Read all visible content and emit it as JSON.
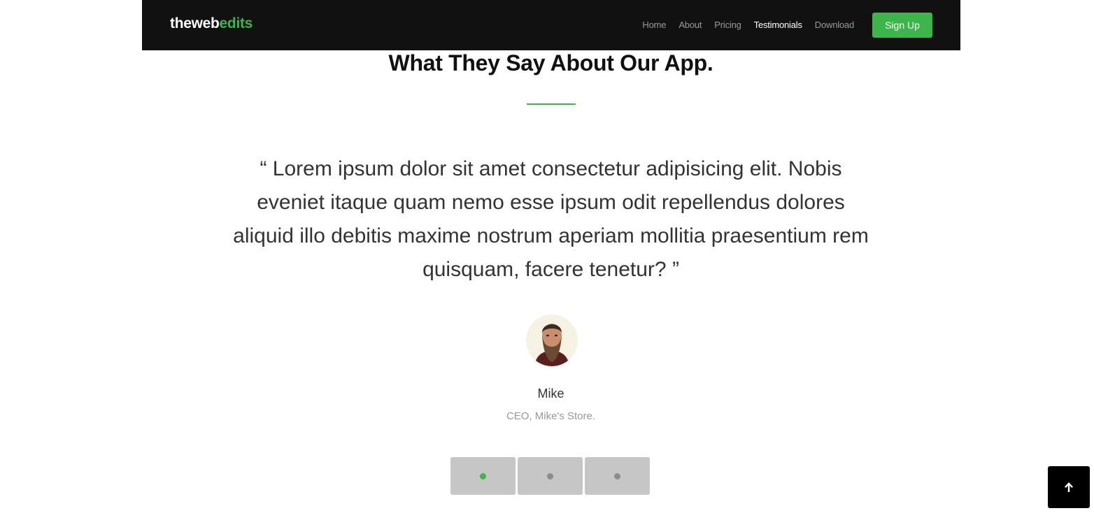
{
  "brand": {
    "prefix": "theweb",
    "accent": "edits",
    "accent_color": "#3cb54a"
  },
  "nav": {
    "items": [
      {
        "label": "Home"
      },
      {
        "label": "About"
      },
      {
        "label": "Pricing"
      },
      {
        "label": "Testimonials",
        "active": true
      },
      {
        "label": "Download"
      }
    ],
    "signup_label": "Sign Up"
  },
  "testimonials": {
    "title": "What They Say About Our App.",
    "quote": "“ Lorem ipsum dolor sit amet consectetur adipisicing elit. Nobis eveniet itaque quam nemo esse ipsum odit repellendus dolores aliquid illo debitis maxime nostrum aperiam mollitia praesentium rem quisquam, facere tenetur? ”",
    "author_name": "Mike",
    "author_role": "CEO, Mike's Store.",
    "slides": 3,
    "active_slide": 1
  },
  "icons": {
    "back_to_top": "arrow-up-icon",
    "avatar": "bearded-man-avatar"
  },
  "colors": {
    "navbar_bg": "#111111",
    "accent": "#3cb54a",
    "pager_bg": "#c6c6c6"
  }
}
